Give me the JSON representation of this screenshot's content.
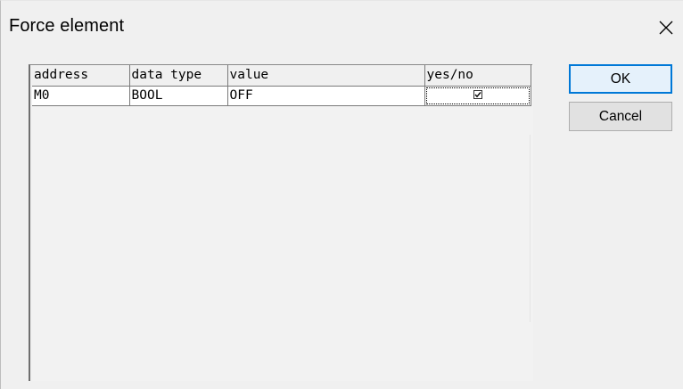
{
  "dialog": {
    "title": "Force element"
  },
  "grid": {
    "columns": [
      "address",
      "data type",
      "value",
      "yes/no"
    ],
    "rows": [
      {
        "address": "M0",
        "data_type": "BOOL",
        "value": "OFF",
        "yes_no_checked": true
      }
    ]
  },
  "buttons": {
    "ok_label": "OK",
    "cancel_label": "Cancel"
  },
  "icons": {
    "close": "close-icon",
    "checkbox": "checkbox-checked"
  },
  "colors": {
    "dialog_bg": "#f0f0f0",
    "default_button_border": "#0078d7",
    "grid_line": "#7a7a7a"
  }
}
